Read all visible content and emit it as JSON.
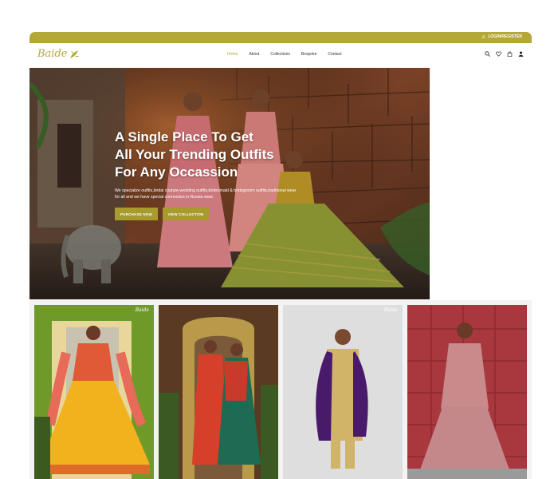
{
  "topbar": {
    "login_label": "LOGIN/REGISTER"
  },
  "brand": {
    "logo_text": "Baide"
  },
  "nav": {
    "items": [
      {
        "label": "Home",
        "active": true
      },
      {
        "label": "About",
        "active": false
      },
      {
        "label": "Collections",
        "active": false
      },
      {
        "label": "Bespoke",
        "active": false
      },
      {
        "label": "Contact",
        "active": false
      }
    ],
    "icons": [
      "search-icon",
      "heart-icon",
      "bag-icon",
      "user-icon"
    ]
  },
  "hero": {
    "title_lines": [
      "A Single Place To Get",
      "All Your Trending Outfits",
      "For Any Occassion"
    ],
    "subtitle": "We specialize outfits,bridal couture,wedding outfits,bridesmaid & bridegroom outfits,traditional wear for all and we have special connection in Russia wear.",
    "buttons": {
      "purchase": "PURCHASE NOW",
      "view": "VIEW COLLECTION"
    }
  },
  "products": {
    "brand_watermark": "Baide"
  },
  "colors": {
    "accent": "#b3a838",
    "button": "#a79b2e"
  }
}
